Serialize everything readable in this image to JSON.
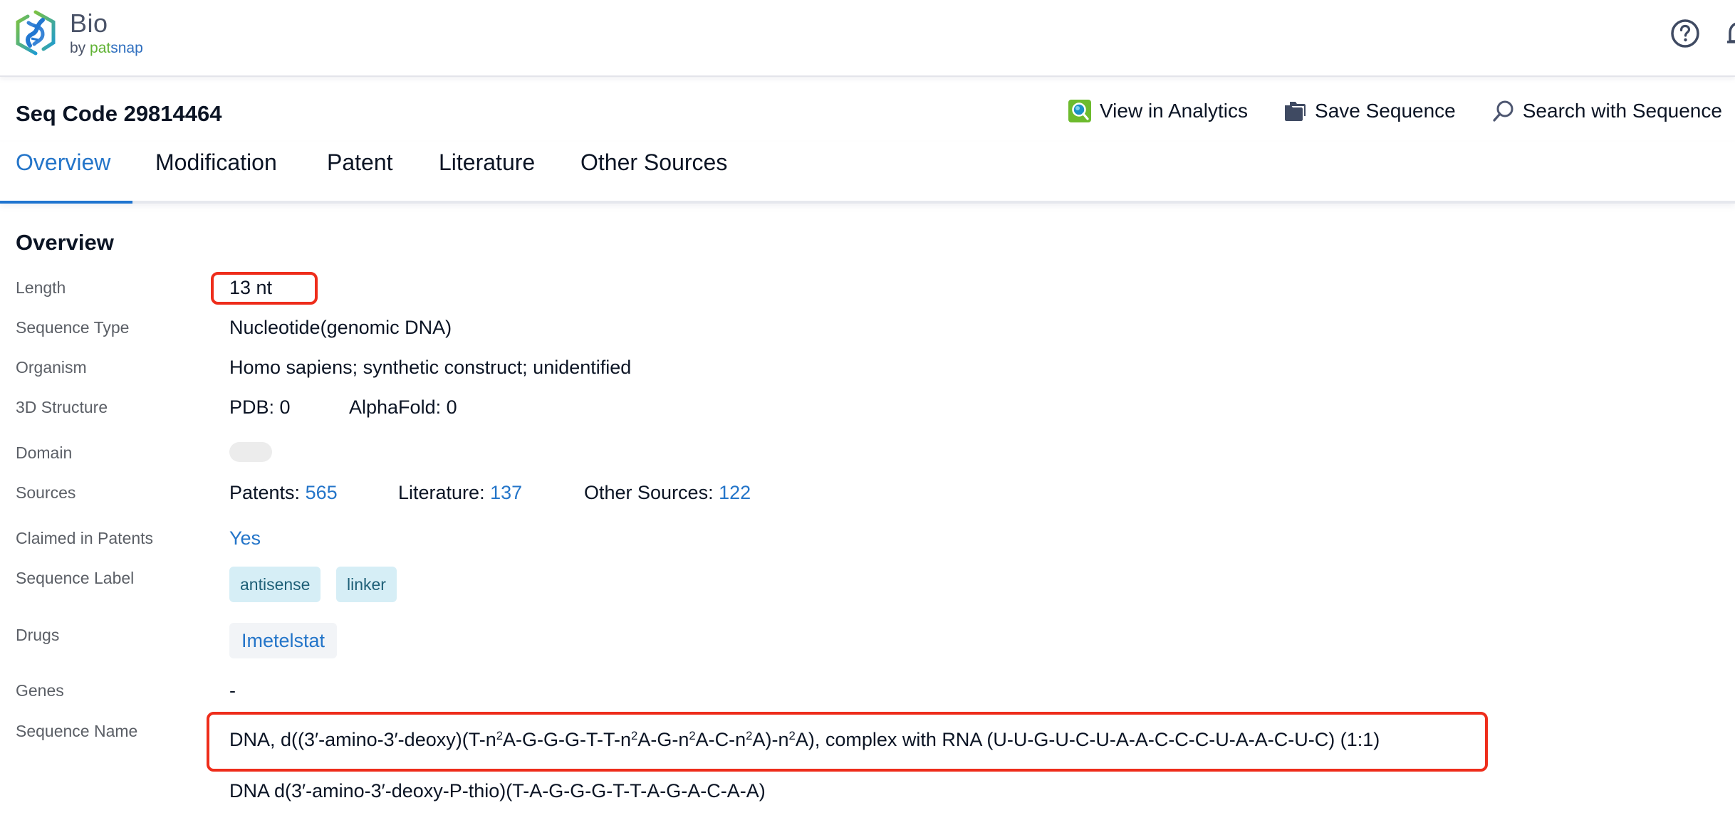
{
  "app": {
    "logo_title": "Bio",
    "logo_by": "by",
    "logo_brand_part1": "pat",
    "logo_brand_part2": "snap",
    "icons": {
      "logo": "dna-hexagon-logo-icon",
      "help": "help-circle-icon",
      "notifications": "bell-icon"
    }
  },
  "header": {
    "title": "Seq Code 29814464",
    "actions": [
      {
        "label": "View in Analytics",
        "icon": "analytics-magnifier-icon"
      },
      {
        "label": "Save Sequence",
        "icon": "folder-icon"
      },
      {
        "label": "Search with Sequence",
        "icon": "search-icon"
      }
    ]
  },
  "tabs": [
    {
      "label": "Overview",
      "active": true
    },
    {
      "label": "Modification",
      "active": false
    },
    {
      "label": "Patent",
      "active": false
    },
    {
      "label": "Literature",
      "active": false
    },
    {
      "label": "Other Sources",
      "active": false
    }
  ],
  "overview": {
    "heading": "Overview",
    "length": {
      "label": "Length",
      "value": "13 nt"
    },
    "sequence_type": {
      "label": "Sequence Type",
      "value": "Nucleotide(genomic DNA)"
    },
    "organism": {
      "label": "Organism",
      "value": "Homo sapiens; synthetic construct; unidentified"
    },
    "structure_3d": {
      "label": "3D Structure",
      "pdb": "PDB: 0",
      "alphafold": "AlphaFold: 0"
    },
    "domain": {
      "label": "Domain",
      "value": ""
    },
    "sources": {
      "label": "Sources",
      "patents_label": "Patents:",
      "patents_count": "565",
      "literature_label": "Literature:",
      "literature_count": "137",
      "other_label": "Other Sources:",
      "other_count": "122"
    },
    "claimed_in_patents": {
      "label": "Claimed in Patents",
      "value": "Yes"
    },
    "sequence_label": {
      "label": "Sequence Label",
      "tags": [
        "antisense",
        "linker"
      ]
    },
    "drugs": {
      "label": "Drugs",
      "items": [
        "Imetelstat"
      ]
    },
    "genes": {
      "label": "Genes",
      "value": "-"
    },
    "sequence_name": {
      "label": "Sequence Name",
      "names": [
        "DNA, d((3′-amino-3′-deoxy)(T-n²A-G-G-G-T-T-n²A-G-n²A-C-n²A)-n²A), complex with RNA (U-U-G-U-C-U-A-A-C-C-C-U-A-A-C-U-C) (1:1)",
        "DNA d(3′-amino-3′-deoxy-P-thio)(T-A-G-G-G-T-T-A-G-A-C-A-A)"
      ]
    }
  },
  "colors": {
    "accent_blue": "#2475c9",
    "highlight_red": "#ee2d1b",
    "tag_bg": "#d6eef6",
    "tag_text": "#1f6078",
    "logo_green": "#5fb233"
  }
}
